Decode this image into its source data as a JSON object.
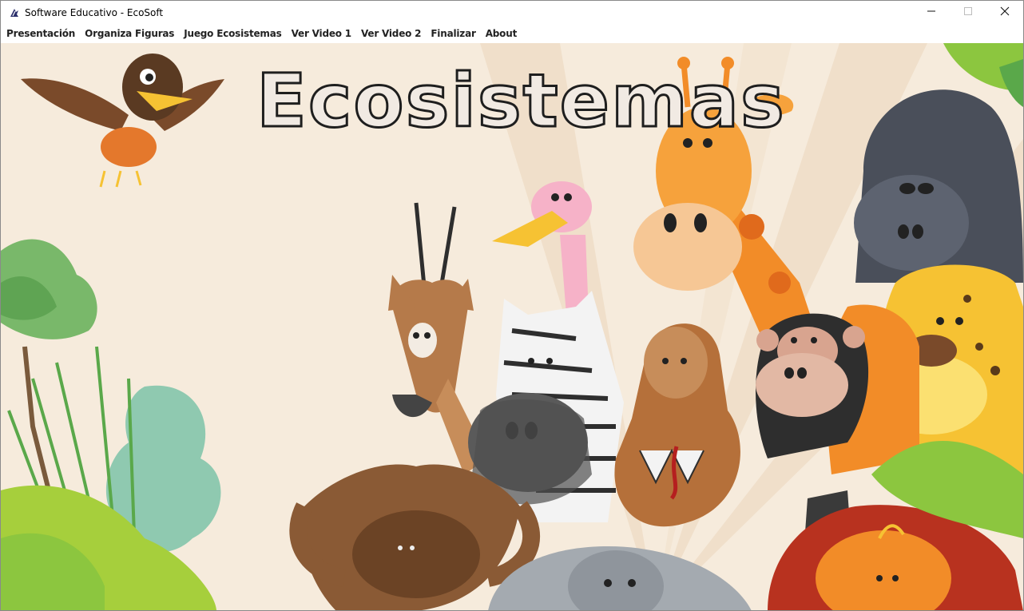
{
  "window": {
    "title": "Software Educativo - EcoSoft",
    "minimize_icon": "minimize-icon",
    "maximize_icon": "maximize-icon",
    "close_icon": "close-icon"
  },
  "menu": {
    "items": [
      {
        "label": "Presentación"
      },
      {
        "label": "Organiza Figuras"
      },
      {
        "label": "Juego Ecosistemas"
      },
      {
        "label": "Ver Video 1"
      },
      {
        "label": "Ver Video 2"
      },
      {
        "label": "Finalizar"
      },
      {
        "label": "About"
      }
    ]
  },
  "main": {
    "headline": "Ecosistemas"
  },
  "colors": {
    "background": "#f6ebdc",
    "headline_fill": "#f1eae3",
    "headline_stroke": "#1e1e1e",
    "giraffe": "#f28c28",
    "gorilla": "#4a4f5a",
    "leopard": "#f6c233",
    "foliage": "#8cc63f"
  }
}
